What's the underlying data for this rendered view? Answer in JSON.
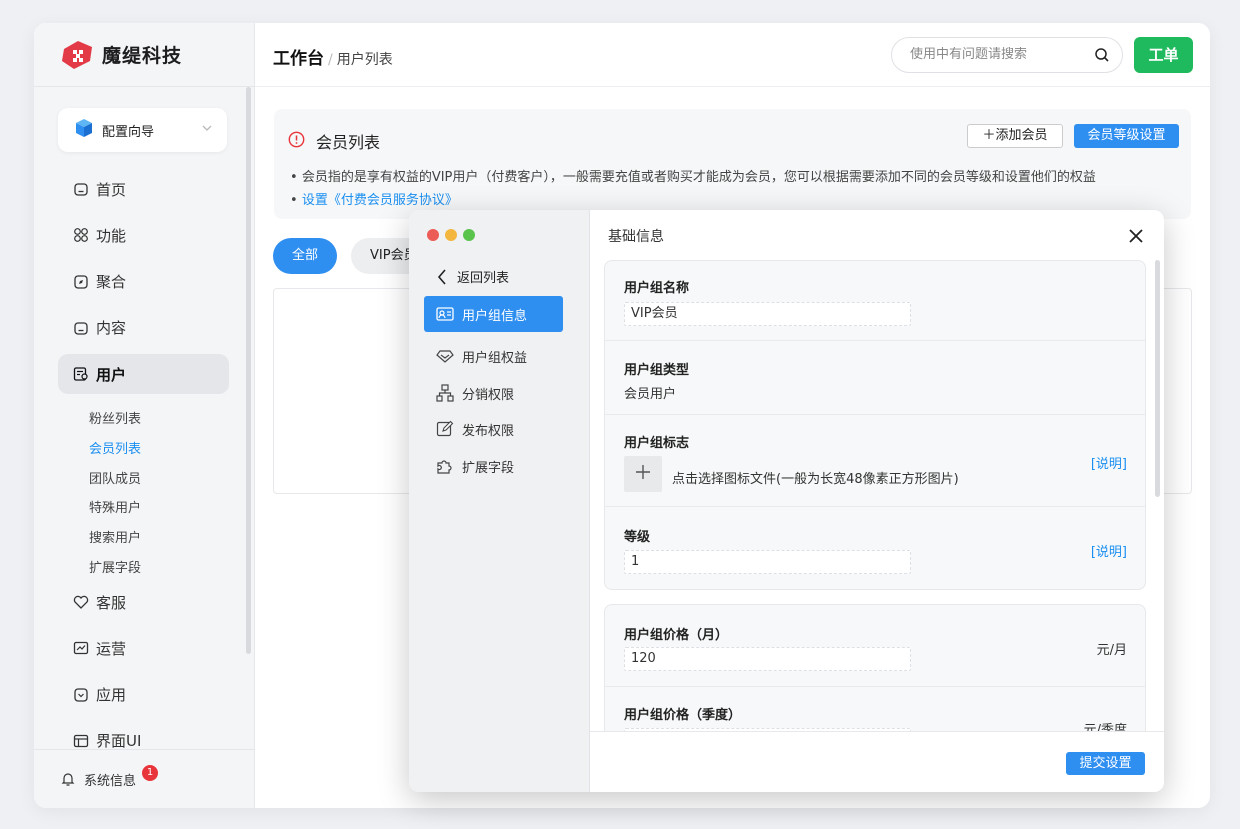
{
  "brand": {
    "name": "魔缇科技"
  },
  "sidebar": {
    "wizard_label": "配置向导",
    "items": [
      {
        "label": "首页",
        "icon": "home-icon"
      },
      {
        "label": "功能",
        "icon": "grid-icon"
      },
      {
        "label": "聚合",
        "icon": "compass-icon"
      },
      {
        "label": "内容",
        "icon": "content-icon"
      },
      {
        "label": "用户",
        "icon": "user-card-icon",
        "active": true
      }
    ],
    "subitems": [
      {
        "label": "粉丝列表"
      },
      {
        "label": "会员列表",
        "active": true
      },
      {
        "label": "团队成员"
      },
      {
        "label": "特殊用户"
      },
      {
        "label": "搜索用户"
      },
      {
        "label": "扩展字段"
      }
    ],
    "items2": [
      {
        "label": "客服",
        "icon": "heart-icon"
      },
      {
        "label": "运营",
        "icon": "chart-icon"
      },
      {
        "label": "应用",
        "icon": "app-icon"
      },
      {
        "label": "界面UI",
        "icon": "layout-icon"
      }
    ],
    "system_info": {
      "label": "系统信息",
      "badge": "1"
    }
  },
  "header": {
    "title": "工作台",
    "separator": "/",
    "subtitle": "用户列表",
    "search_placeholder": "使用中有问题请搜索",
    "ticket_label": "工单"
  },
  "notice": {
    "title": "会员列表",
    "description": "会员指的是享有权益的VIP用户（付费客户），一般需要充值或者购买才能成为会员，您可以根据需要添加不同的会员等级和设置他们的权益",
    "link": "设置《付费会员服务协议》",
    "add_button": "添加会员",
    "level_button": "会员等级设置"
  },
  "tabs": [
    {
      "label": "全部",
      "active": true
    },
    {
      "label": "VIP会员"
    }
  ],
  "modal": {
    "back_label": "返回列表",
    "nav": [
      {
        "label": "用户组信息",
        "icon": "id-card-icon",
        "active": true
      },
      {
        "label": "用户组权益",
        "icon": "diamond-icon"
      },
      {
        "label": "分销权限",
        "icon": "org-chart-icon"
      },
      {
        "label": "发布权限",
        "icon": "edit-icon"
      },
      {
        "label": "扩展字段",
        "icon": "puzzle-icon"
      }
    ],
    "section_title": "基础信息",
    "fields": {
      "group_name": {
        "label": "用户组名称",
        "value": "VIP会员"
      },
      "group_type": {
        "label": "用户组类型",
        "value": "会员用户"
      },
      "group_logo": {
        "label": "用户组标志",
        "hint": "点击选择图标文件(一般为长宽48像素正方形图片)",
        "note": "[说明]"
      },
      "level": {
        "label": "等级",
        "value": "1",
        "note": "[说明]"
      },
      "price_month": {
        "label": "用户组价格（月）",
        "value": "120",
        "unit": "元/月"
      },
      "price_quarter": {
        "label": "用户组价格（季度）",
        "value": "",
        "unit": "元/季度"
      }
    },
    "submit_label": "提交设置"
  },
  "colors": {
    "accent": "#2e8ff0",
    "ticket": "#1fba5d",
    "badge": "#e8353b",
    "warning": "#e8353b"
  }
}
